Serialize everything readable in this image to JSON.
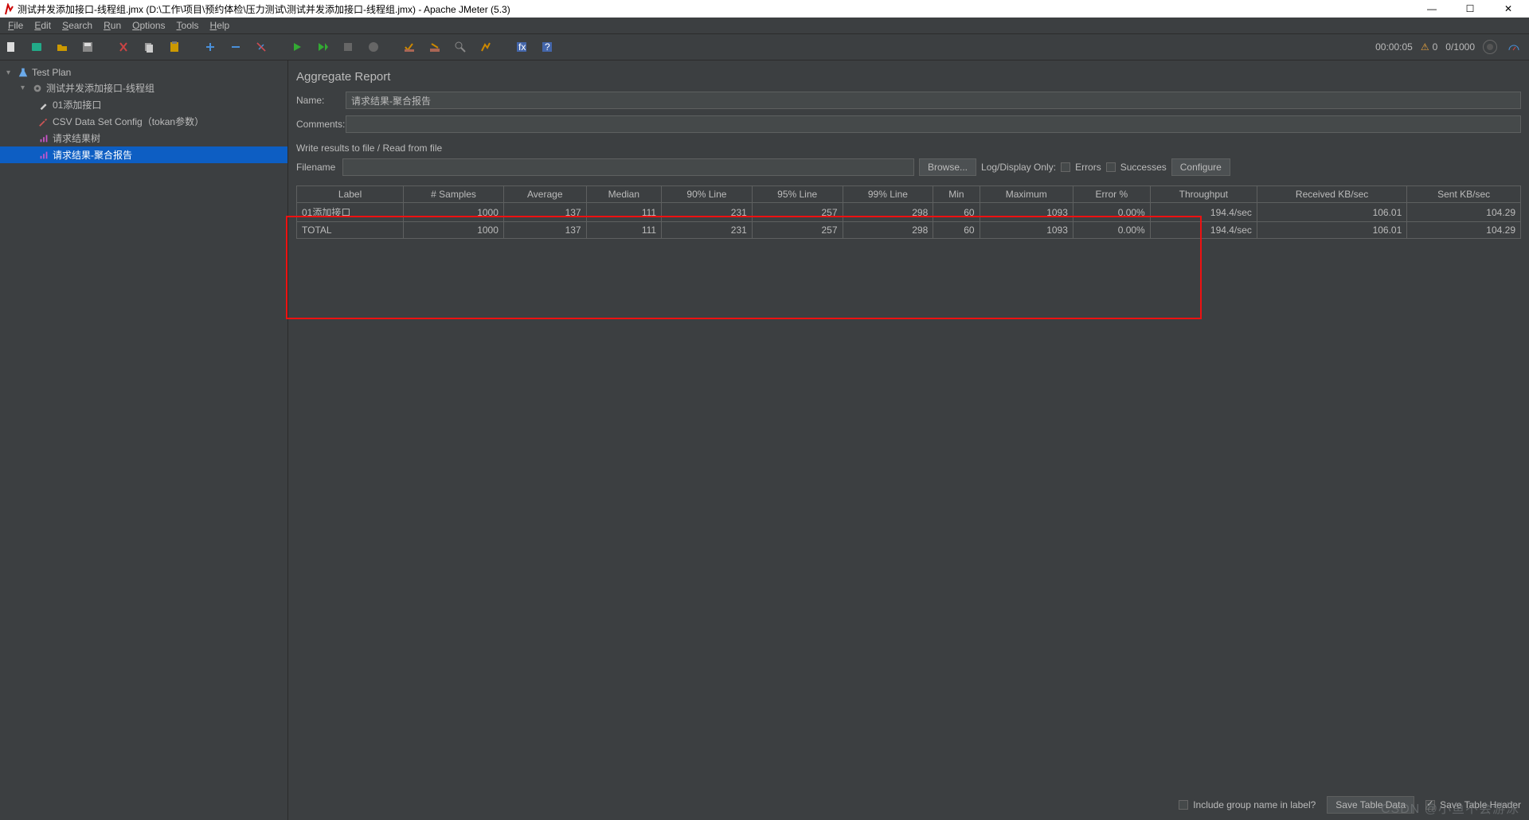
{
  "window": {
    "title": "测试并发添加接口-线程组.jmx (D:\\工作\\项目\\预约体检\\压力测试\\测试并发添加接口-线程组.jmx) - Apache JMeter (5.3)"
  },
  "window_controls": {
    "min": "—",
    "max": "☐",
    "close": "✕"
  },
  "menu": {
    "file": "File",
    "edit": "Edit",
    "search": "Search",
    "run": "Run",
    "options": "Options",
    "tools": "Tools",
    "help": "Help"
  },
  "toolbar_status": {
    "timer": "00:00:05",
    "warnings": "0",
    "threads": "0/1000"
  },
  "tree": {
    "root": "Test Plan",
    "thread_group": "测试并发添加接口-线程组",
    "items": [
      {
        "label": "01添加接口"
      },
      {
        "label": "CSV Data Set Config（tokan参数）"
      },
      {
        "label": "请求结果树"
      },
      {
        "label": "请求结果-聚合报告"
      }
    ]
  },
  "panel": {
    "title": "Aggregate Report",
    "name_label": "Name:",
    "name_value": "请求结果-聚合报告",
    "comments_label": "Comments:",
    "comments_value": "",
    "section": "Write results to file / Read from file",
    "filename_label": "Filename",
    "browse": "Browse...",
    "log_label": "Log/Display Only:",
    "errors": "Errors",
    "successes": "Successes",
    "configure": "Configure"
  },
  "table": {
    "headers": [
      "Label",
      "# Samples",
      "Average",
      "Median",
      "90% Line",
      "95% Line",
      "99% Line",
      "Min",
      "Maximum",
      "Error %",
      "Throughput",
      "Received KB/sec",
      "Sent KB/sec"
    ],
    "rows": [
      {
        "label": "01添加接口",
        "samples": "1000",
        "avg": "137",
        "median": "111",
        "p90": "231",
        "p95": "257",
        "p99": "298",
        "min": "60",
        "max": "1093",
        "err": "0.00%",
        "thr": "194.4/sec",
        "recv": "106.01",
        "sent": "104.29"
      },
      {
        "label": "TOTAL",
        "samples": "1000",
        "avg": "137",
        "median": "111",
        "p90": "231",
        "p95": "257",
        "p99": "298",
        "min": "60",
        "max": "1093",
        "err": "0.00%",
        "thr": "194.4/sec",
        "recv": "106.01",
        "sent": "104.29"
      }
    ]
  },
  "bottom": {
    "include_group": "Include group name in label?",
    "save_table": "Save Table Data",
    "save_header": "Save Table Header"
  },
  "watermark": "CSDN @小鱼不会游泳",
  "chart_data": {
    "type": "table",
    "title": "Aggregate Report",
    "columns": [
      "Label",
      "# Samples",
      "Average",
      "Median",
      "90% Line",
      "95% Line",
      "99% Line",
      "Min",
      "Maximum",
      "Error %",
      "Throughput",
      "Received KB/sec",
      "Sent KB/sec"
    ],
    "rows": [
      [
        "01添加接口",
        1000,
        137,
        111,
        231,
        257,
        298,
        60,
        1093,
        "0.00%",
        "194.4/sec",
        106.01,
        104.29
      ],
      [
        "TOTAL",
        1000,
        137,
        111,
        231,
        257,
        298,
        60,
        1093,
        "0.00%",
        "194.4/sec",
        106.01,
        104.29
      ]
    ]
  }
}
